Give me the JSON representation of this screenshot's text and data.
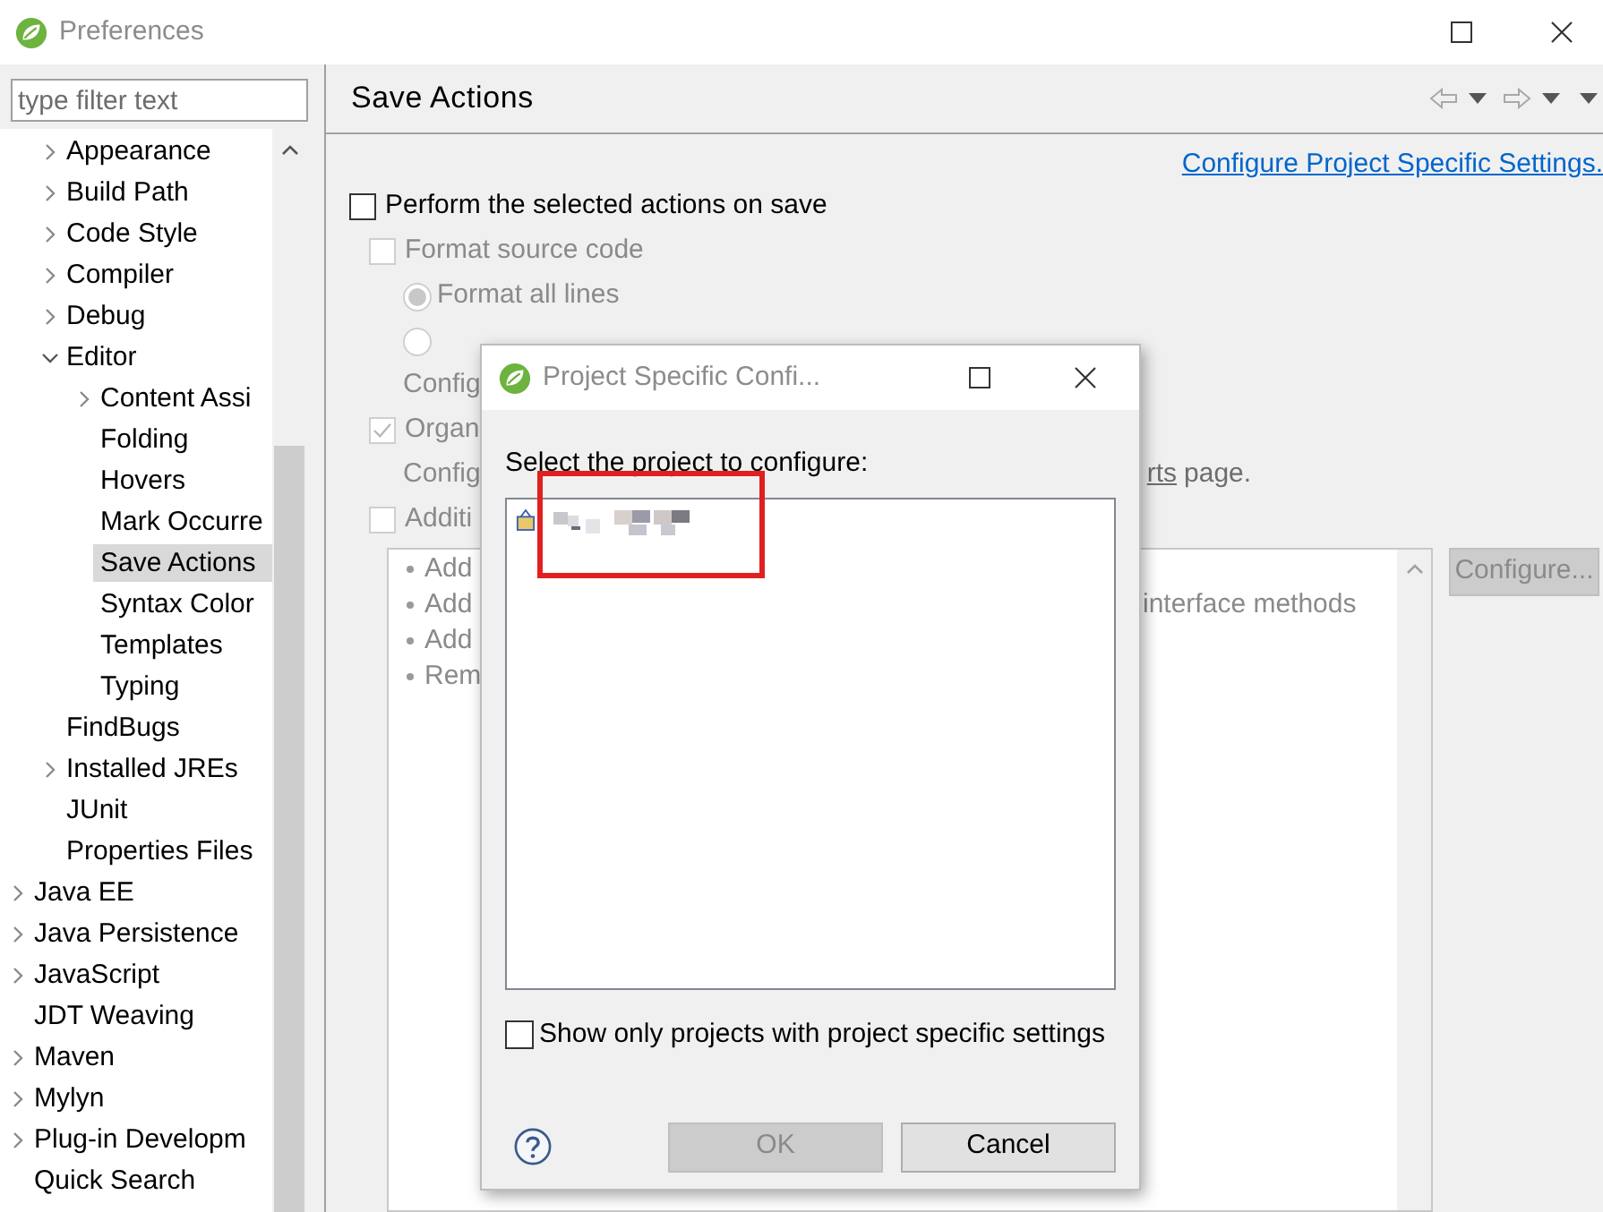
{
  "window": {
    "title": "Preferences"
  },
  "filter": {
    "placeholder": "type filter text"
  },
  "tree": {
    "continued_items": [
      {
        "label": "Appearance",
        "expandable": true,
        "expanded": false,
        "selected": false
      },
      {
        "label": "Build Path",
        "expandable": true,
        "expanded": false,
        "selected": false
      },
      {
        "label": "Code Style",
        "expandable": true,
        "expanded": false,
        "selected": false
      },
      {
        "label": "Compiler",
        "expandable": true,
        "expanded": false,
        "selected": false
      },
      {
        "label": "Debug",
        "expandable": true,
        "expanded": false,
        "selected": false
      },
      {
        "label": "Editor",
        "expandable": true,
        "expanded": true,
        "selected": false,
        "children": [
          {
            "label": "Content Assi",
            "expandable": true,
            "expanded": false,
            "selected": false
          },
          {
            "label": "Folding",
            "expandable": false,
            "selected": false
          },
          {
            "label": "Hovers",
            "expandable": false,
            "selected": false
          },
          {
            "label": "Mark Occurre",
            "expandable": false,
            "selected": false
          },
          {
            "label": "Save Actions",
            "expandable": false,
            "selected": true
          },
          {
            "label": "Syntax Color",
            "expandable": false,
            "selected": false
          },
          {
            "label": "Templates",
            "expandable": false,
            "selected": false
          },
          {
            "label": "Typing",
            "expandable": false,
            "selected": false
          }
        ]
      },
      {
        "label": "FindBugs",
        "expandable": false,
        "selected": false
      },
      {
        "label": "Installed JREs",
        "expandable": true,
        "expanded": false,
        "selected": false
      },
      {
        "label": "JUnit",
        "expandable": false,
        "selected": false
      },
      {
        "label": "Properties Files",
        "expandable": false,
        "selected": false
      }
    ],
    "items": [
      {
        "label": "Java EE",
        "expandable": true,
        "expanded": false,
        "selected": false
      },
      {
        "label": "Java Persistence",
        "expandable": true,
        "expanded": false,
        "selected": false
      },
      {
        "label": "JavaScript",
        "expandable": true,
        "expanded": false,
        "selected": false
      },
      {
        "label": "JDT Weaving",
        "expandable": false,
        "selected": false
      },
      {
        "label": "Maven",
        "expandable": true,
        "expanded": false,
        "selected": false
      },
      {
        "label": "Mylyn",
        "expandable": true,
        "expanded": false,
        "selected": false
      },
      {
        "label": "Plug-in Developm",
        "expandable": true,
        "expanded": false,
        "selected": false
      },
      {
        "label": "Quick Search",
        "expandable": false,
        "selected": false
      }
    ]
  },
  "page": {
    "title": "Save Actions",
    "link": "Configure Project Specific Settings.",
    "options": [
      {
        "kind": "checkbox",
        "label": "Perform the selected actions on save",
        "checked": false,
        "disabled": false,
        "children": [
          {
            "kind": "checkbox",
            "label": "Format source code",
            "checked": false,
            "disabled": true,
            "children": [
              {
                "kind": "radio",
                "label": "Format all lines",
                "selected": true,
                "disabled": true
              },
              {
                "kind": "radio",
                "selected": false,
                "disabled": true
              },
              {
                "kind": "text",
                "label": "Config",
                "disabled": true
              }
            ]
          },
          {
            "kind": "checkbox",
            "label": "Organ",
            "checked": true,
            "disabled": true,
            "children": [
              {
                "kind": "text",
                "label": "Config",
                "disabled": true,
                "link_part": "rts",
                "after": "page."
              }
            ]
          },
          {
            "kind": "checkbox",
            "label": "Additi",
            "checked": false,
            "disabled": true
          }
        ]
      }
    ],
    "actions_list": [
      {
        "label": "Add"
      },
      {
        "label": "Add",
        "trailing": "interface methods"
      },
      {
        "label": "Add"
      },
      {
        "label": "Rem"
      }
    ],
    "configure_button": {
      "label": "Configure...",
      "disabled": true
    }
  },
  "dialog": {
    "title": "Project Specific Confi...",
    "prompt": "Select the project to configure:",
    "annotation": {
      "kind": "rectangle"
    },
    "filter_checkbox": {
      "label": "Show only projects with project specific settings",
      "checked": false
    },
    "buttons": [
      {
        "label": "OK",
        "disabled": true
      },
      {
        "label": "Cancel",
        "disabled": false
      }
    ]
  }
}
